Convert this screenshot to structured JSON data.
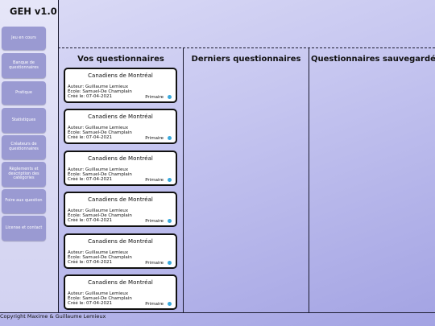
{
  "app": {
    "title": "GEH v1.0"
  },
  "sidebar": {
    "items": [
      {
        "label": "Jeu en cours"
      },
      {
        "label": "Banque de questionnaires"
      },
      {
        "label": "Pratique"
      },
      {
        "label": "Statistiques"
      },
      {
        "label": "Créateurs de questionnaires"
      },
      {
        "label": "Règlements et description des catégories"
      },
      {
        "label": "Foire aux question"
      },
      {
        "label": "License et contact"
      }
    ]
  },
  "columns": [
    {
      "title": "Vos questionnaires"
    },
    {
      "title": "Derniers questionnaires"
    },
    {
      "title": "Questionnaires sauvegardés"
    }
  ],
  "cards": [
    {
      "title": "Canadiens de Montréal",
      "author": "Auteur: Guillaume Lemieux",
      "school": "École: Samuel-De Champlain",
      "created": "Créé le: 07-04-2021",
      "level": "Primaire",
      "status_color": "#3aa9dc"
    },
    {
      "title": "Canadiens de Montréal",
      "author": "Auteur: Guillaume Lemieux",
      "school": "École: Samuel-De Champlain",
      "created": "Créé le: 07-04-2021",
      "level": "Primaire",
      "status_color": "#3aa9dc"
    },
    {
      "title": "Canadiens de Montréal",
      "author": "Auteur: Guillaume Lemieux",
      "school": "École: Samuel-De Champlain",
      "created": "Créé le: 07-04-2021",
      "level": "Primaire",
      "status_color": "#3aa9dc"
    },
    {
      "title": "Canadiens de Montréal",
      "author": "Auteur: Guillaume Lemieux",
      "school": "École: Samuel-De Champlain",
      "created": "Créé le: 07-04-2021",
      "level": "Primaire",
      "status_color": "#3aa9dc"
    },
    {
      "title": "Canadiens de Montréal",
      "author": "Auteur: Guillaume Lemieux",
      "school": "École: Samuel-De Champlain",
      "created": "Créé le: 07-04-2021",
      "level": "Primaire",
      "status_color": "#3aa9dc"
    },
    {
      "title": "Canadiens de Montréal",
      "author": "Auteur: Guillaume Lemieux",
      "school": "École: Samuel-De Champlain",
      "created": "Créé le: 07-04-2021",
      "level": "Primaire",
      "status_color": "#3aa9dc"
    }
  ],
  "footer": {
    "copyright": "Copyright Maxime & Guillaume Lemieux"
  }
}
